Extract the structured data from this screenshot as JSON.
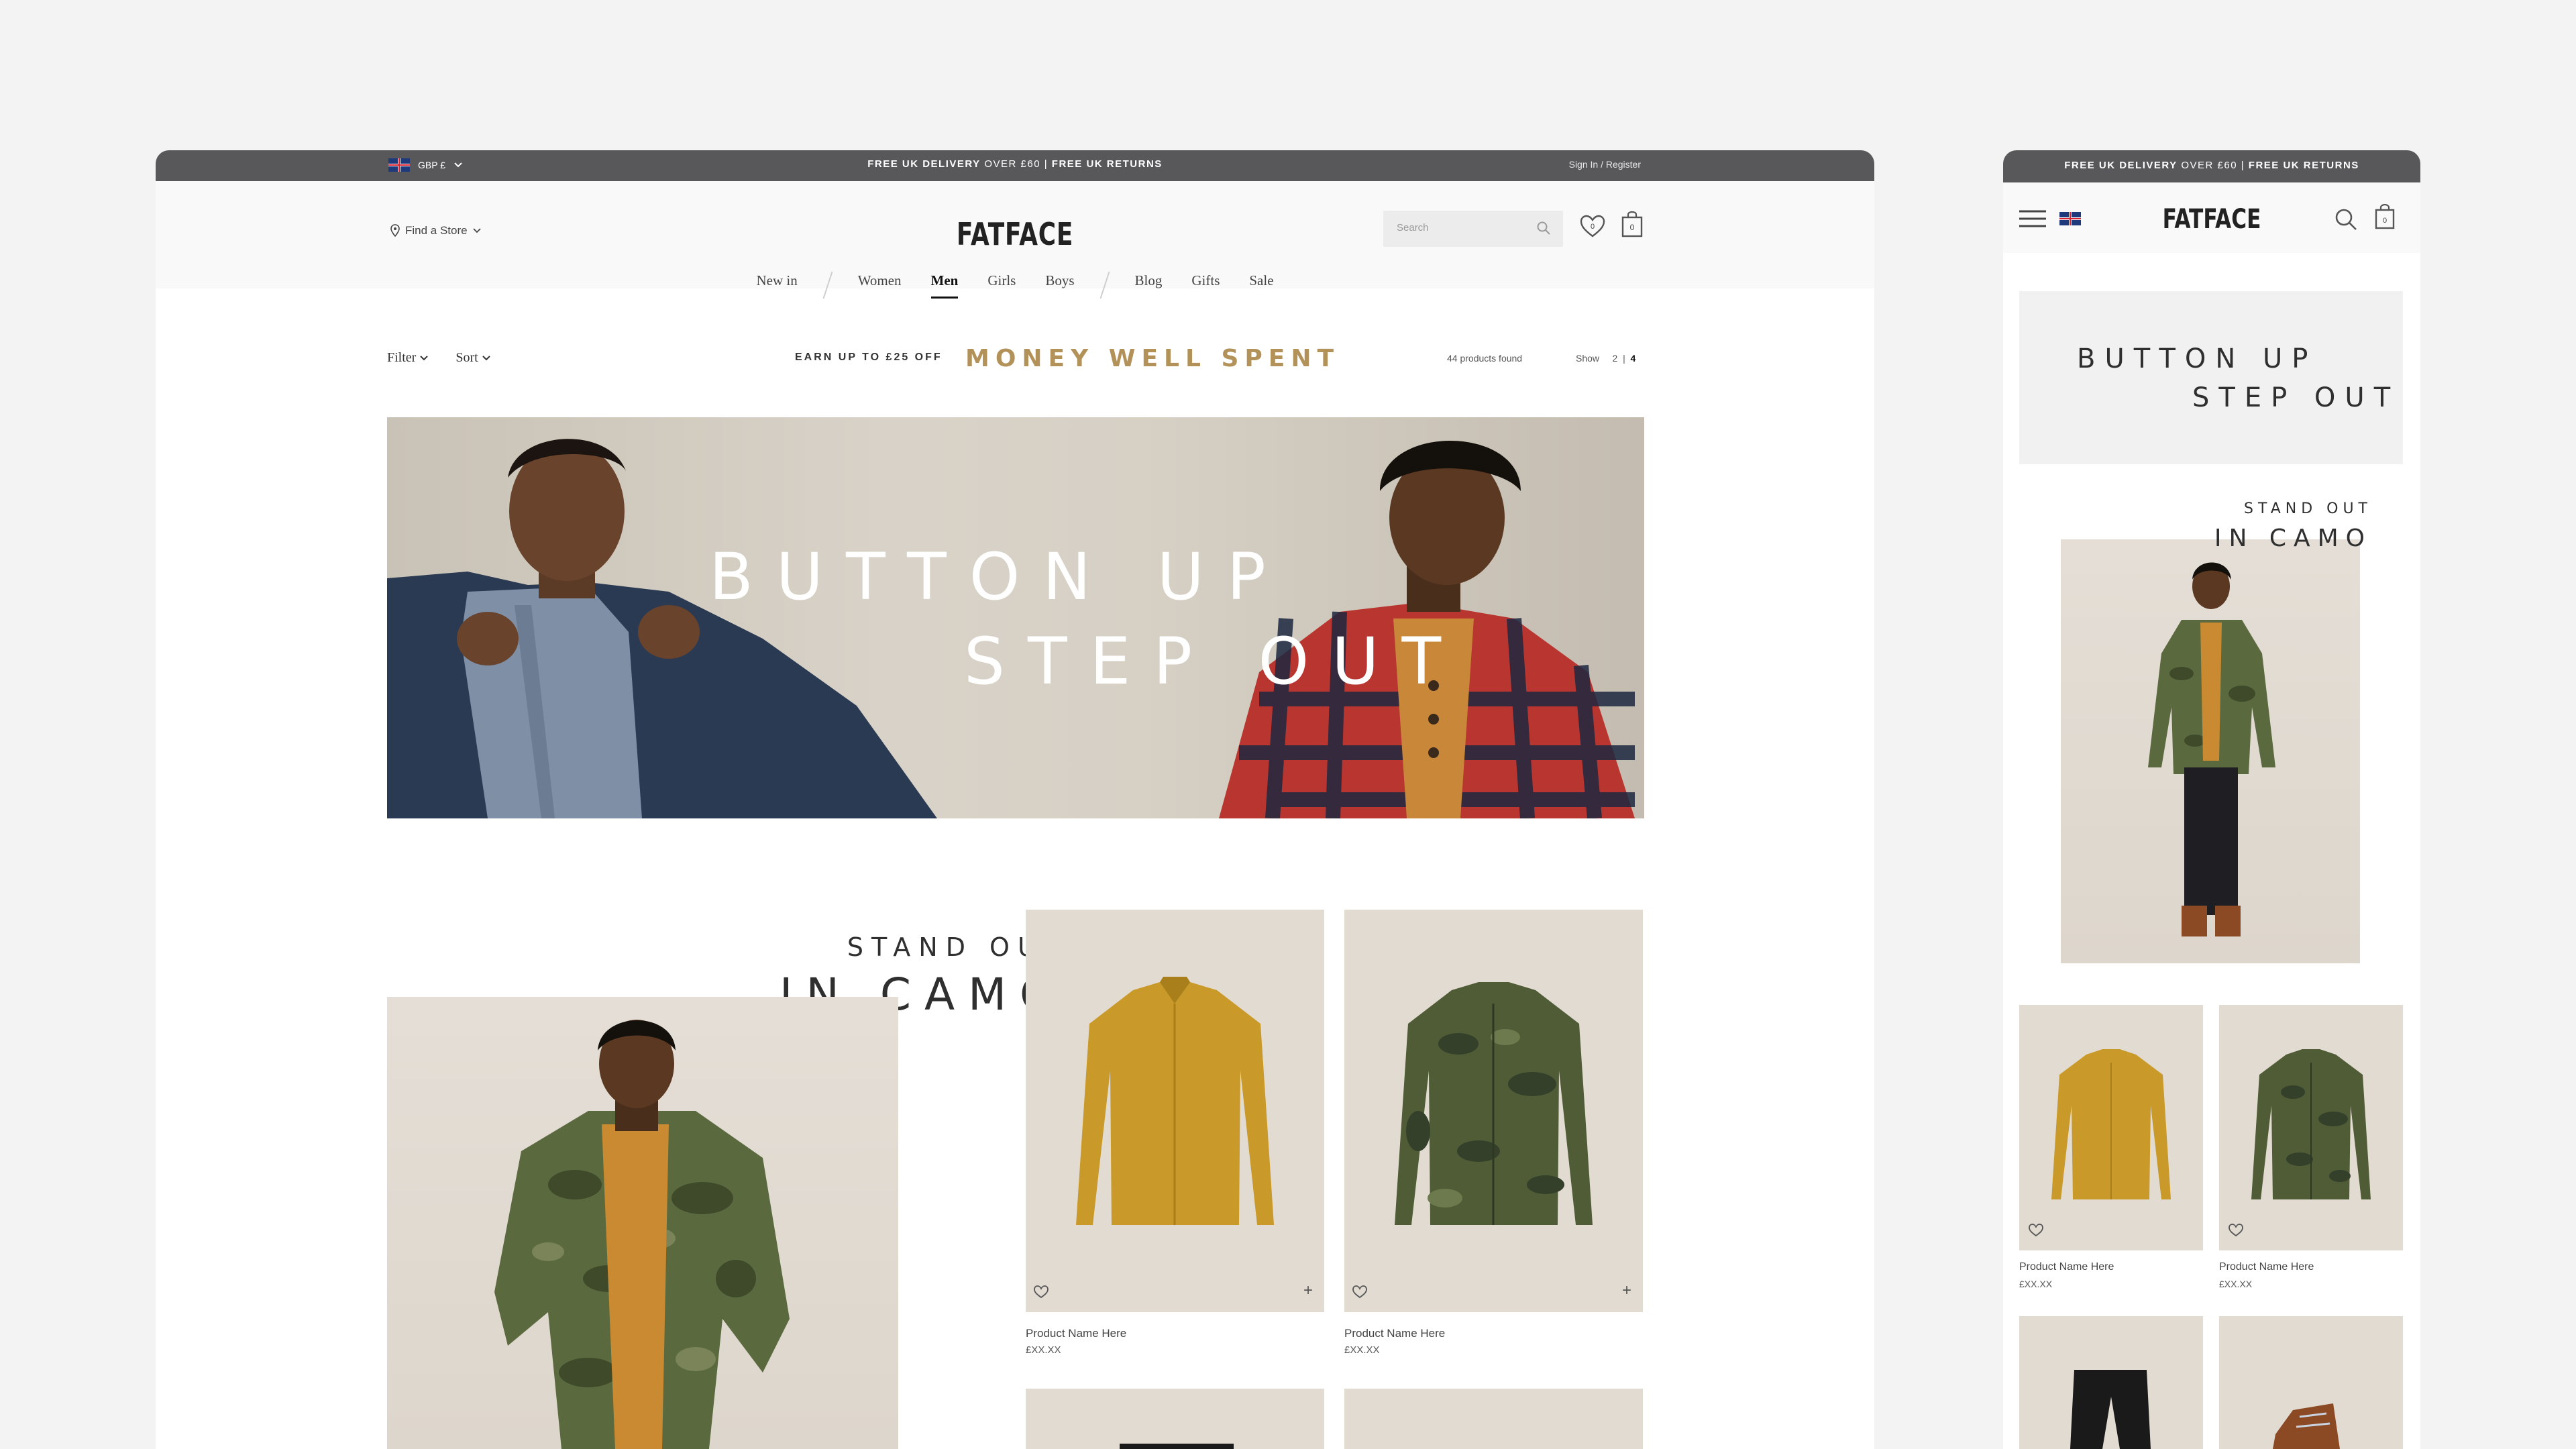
{
  "desktop": {
    "topbar": {
      "currency": "GBP £",
      "delivery_bold": "FREE UK DELIVERY",
      "delivery_mid": " OVER £60 | ",
      "returns_bold": "FREE UK RETURNS",
      "signin": "Sign In / Register"
    },
    "header": {
      "find_store": "Find a Store",
      "logo": "FATFACE",
      "search_placeholder": "Search",
      "wishlist_count": "0",
      "bag_count": "0"
    },
    "nav": {
      "items": [
        "New in",
        "Women",
        "Men",
        "Girls",
        "Boys",
        "Blog",
        "Gifts",
        "Sale"
      ],
      "active": "Men"
    },
    "filterbar": {
      "filter": "Filter",
      "sort": "Sort",
      "earn": "EARN UP TO £25 OFF",
      "money": "MONEY WELL SPENT",
      "count": "44 products found",
      "show_label": "Show",
      "show_a": "2",
      "show_sep": "|",
      "show_b": "4"
    },
    "hero": {
      "line1": "BUTTON UP",
      "line2": "STEP OUT"
    },
    "camo": {
      "line1": "STAND OUT",
      "line2": "IN CAMO"
    },
    "products": [
      {
        "name": "Product Name Here",
        "price": "£XX.XX"
      },
      {
        "name": "Product Name Here",
        "price": "£XX.XX"
      }
    ]
  },
  "mobile": {
    "topbar": {
      "delivery_bold": "FREE UK DELIVERY",
      "delivery_mid": " OVER £60 | ",
      "returns_bold": "FREE UK RETURNS"
    },
    "logo": "FATFACE",
    "bag_count": "0",
    "banner": {
      "line1": "BUTTON UP",
      "line2": "STEP OUT"
    },
    "camo": {
      "line1": "STAND OUT",
      "line2": "IN CAMO"
    },
    "products": [
      {
        "name": "Product Name Here",
        "price": "£XX.XX"
      },
      {
        "name": "Product Name Here",
        "price": "£XX.XX"
      }
    ]
  },
  "colors": {
    "topbar": "#58585a",
    "accent_gold": "#b3925a",
    "page_bg": "#f3f3f3"
  }
}
